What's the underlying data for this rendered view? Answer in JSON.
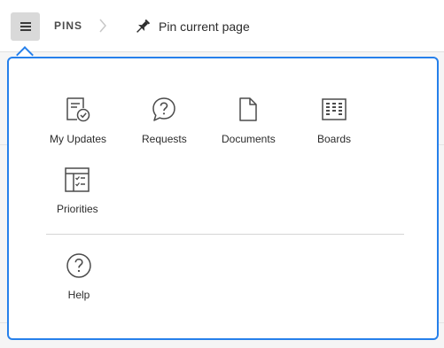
{
  "header": {
    "menu_icon": "hamburger-icon",
    "pins_label": "PINS",
    "separator_icon": "chevron-right-icon",
    "pin_icon": "pushpin-icon",
    "pin_current_label": "Pin current page"
  },
  "menu": {
    "items": [
      {
        "label": "My Updates",
        "icon": "updates-icon"
      },
      {
        "label": "Requests",
        "icon": "question-bubble-icon"
      },
      {
        "label": "Documents",
        "icon": "document-icon"
      },
      {
        "label": "Boards",
        "icon": "board-icon"
      },
      {
        "label": "Priorities",
        "icon": "checklist-icon"
      }
    ],
    "help": {
      "label": "Help",
      "icon": "help-circle-icon"
    }
  },
  "colors": {
    "accent": "#2680eb",
    "icon": "#4b4b4b",
    "button_bg": "#d9d9d9"
  }
}
